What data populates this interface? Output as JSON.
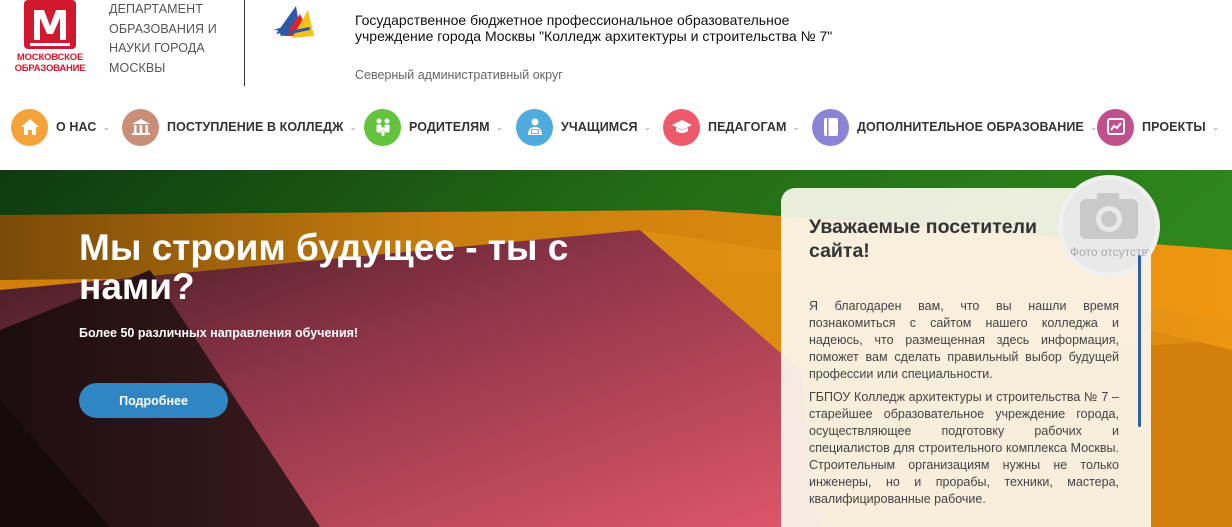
{
  "header": {
    "mo_logo_text": "МОСКОВСКОЕ ОБРАЗОВАНИЕ",
    "department_lines": [
      "ДЕПАРТАМЕНТ",
      "ОБРАЗОВАНИЯ И",
      "НАУКИ ГОРОДА",
      "МОСКВЫ"
    ],
    "college_name": "Государственное бюджетное профессиональное образовательное учреждение города Москвы \"Колледж архитектуры и строительства № 7\"",
    "district": "Северный административный округ"
  },
  "nav": {
    "items": [
      {
        "label": "О НАС",
        "icon": "home-icon",
        "color": "#f6a23a",
        "has_dropdown": true
      },
      {
        "label": "ПОСТУПЛЕНИЕ В КОЛЛЕДЖ",
        "icon": "building-icon",
        "color": "#c98e78",
        "has_dropdown": true
      },
      {
        "label": "РОДИТЕЛЯМ",
        "icon": "family-icon",
        "color": "#63c33c",
        "has_dropdown": true
      },
      {
        "label": "УЧАЩИМСЯ",
        "icon": "student-icon",
        "color": "#4faadd",
        "has_dropdown": true
      },
      {
        "label": "ПЕДАГОГАМ",
        "icon": "graduation-cap-icon",
        "color": "#ee5a6c",
        "has_dropdown": true
      },
      {
        "label": "ДОПОЛНИТЕЛЬНОЕ ОБРАЗОВАНИЕ",
        "icon": "book-icon",
        "color": "#8b83d6",
        "has_dropdown": true
      },
      {
        "label": "ПРОЕКТЫ",
        "icon": "chart-board-icon",
        "color": "#c04f8e",
        "has_dropdown": true
      }
    ]
  },
  "hero": {
    "title": "Мы строим будущее - ты с нами?",
    "subtitle": "Более 50 различных направления обучения!",
    "button_label": "Подробнее"
  },
  "welcome": {
    "title": "Уважаемые посетители сайта!",
    "photo_missing_text": "Фото отсутствует",
    "paragraphs": [
      "Я благодарен вам, что вы нашли время познакомиться с сайтом нашего колледжа и надеюсь, что размещенная здесь информация, поможет вам сделать правильный выбор будущей профессии или специальности.",
      "ГБПОУ Колледж архитектуры и строительства № 7 – старейшее образовательное учреждение города, осуществляющее подготовку рабочих и специалистов для строительного комплекса Москвы. Строительным организациям нужны не только инженеры, но и прорабы, техники, мастера, квалифицированные рабочие."
    ]
  },
  "colors": {
    "brand_red": "#d1182f",
    "button_blue": "#2f86c3",
    "hero_green": "#2f7f1c",
    "hero_orange": "#e08a12",
    "hero_pink": "#d94f64",
    "hero_dark": "#3a1a1c"
  }
}
